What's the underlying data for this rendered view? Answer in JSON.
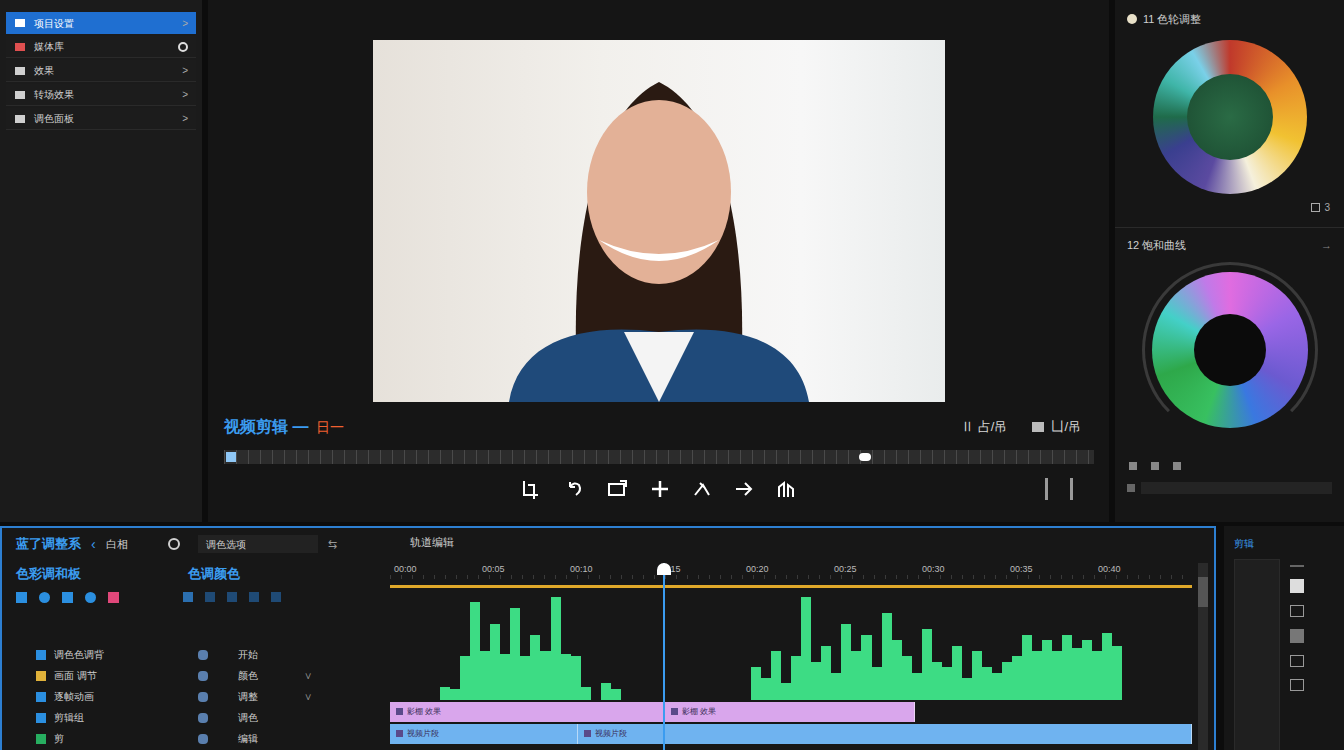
{
  "sidebar": {
    "items": [
      {
        "label": "项目设置",
        "kind": "arrow",
        "arrow": ">",
        "selected": true
      },
      {
        "label": "媒体库",
        "kind": "toggle",
        "arrow": "",
        "selected": false
      },
      {
        "label": "效果",
        "kind": "arrow",
        "arrow": ">",
        "selected": false
      },
      {
        "label": "转场效果",
        "kind": "arrow",
        "arrow": ">",
        "selected": false
      },
      {
        "label": "调色面板",
        "kind": "arrow",
        "arrow": ">",
        "selected": false
      }
    ]
  },
  "preview": {
    "title": "视频剪辑 —",
    "timecode": "日一",
    "tools": [
      "Ⅱ 占/吊",
      "凵/吊"
    ],
    "scrubber": {
      "level": 0.73
    }
  },
  "color_panel": {
    "wheel_title": "11 色轮调整",
    "wheel_badge": "3",
    "curve_title": "12 饱和曲线",
    "curve_arrow": "→"
  },
  "timeline": {
    "title": "蓝了调整系",
    "back": "‹",
    "mode": "白相",
    "field": "调色选项",
    "swap": "⇆",
    "track_title": "轨道编辑",
    "section_left": "色彩调和板",
    "section_right": "色调颜色",
    "ruler": [
      "00:00",
      "00:05",
      "00:10",
      "00:15",
      "00:20",
      "00:25",
      "00:30",
      "00:35",
      "00:40"
    ],
    "playhead": {
      "level": 0.34
    },
    "tracks": [
      {
        "name": "调色色调背",
        "color": "#2b8fe0",
        "prop": "开始",
        "arrow": ""
      },
      {
        "name": "画面 调节",
        "color": "#e0b23a",
        "prop": "颜色",
        "arrow": "∨"
      },
      {
        "name": "逐帧动画",
        "color": "#2b8fe0",
        "prop": "调整",
        "arrow": "∨"
      },
      {
        "name": "剪辑组",
        "color": "#2b8fe0",
        "prop": "调色",
        "arrow": ""
      },
      {
        "name": "剪",
        "color": "#27ae60",
        "prop": "编辑",
        "arrow": ""
      }
    ],
    "waveform": {
      "values": [
        0,
        0,
        0,
        0,
        0,
        12,
        10,
        40,
        90,
        45,
        70,
        42,
        85,
        40,
        60,
        45,
        95,
        42,
        40,
        12,
        0,
        15,
        10,
        0,
        0,
        0,
        0,
        0,
        0,
        0,
        0,
        0,
        0,
        0,
        0,
        0,
        30,
        20,
        45,
        15,
        40,
        95,
        35,
        50,
        25,
        70,
        45,
        60,
        30,
        80,
        55,
        40,
        25,
        65,
        35,
        30,
        50,
        20,
        45,
        30,
        25,
        35,
        40,
        60,
        45,
        55,
        45,
        60,
        48,
        55,
        45,
        62,
        50,
        0,
        0,
        0,
        0,
        0,
        0,
        0
      ]
    },
    "clips": [
      {
        "label": "影棚 效果",
        "row": "overlay",
        "start": 0,
        "end": 0.343,
        "color": "#d9a6ec"
      },
      {
        "label": "影棚 效果",
        "row": "overlay",
        "start": 0.343,
        "end": 0.655,
        "color": "#d9a6ec"
      },
      {
        "label": "视频片段",
        "row": "video",
        "start": 0,
        "end": 0.234,
        "color": "#6fb3f0"
      },
      {
        "label": "视频片段",
        "row": "video",
        "start": 0.234,
        "end": 1,
        "color": "#6fb3f0"
      }
    ]
  },
  "clip_panel": {
    "title": "剪辑"
  }
}
